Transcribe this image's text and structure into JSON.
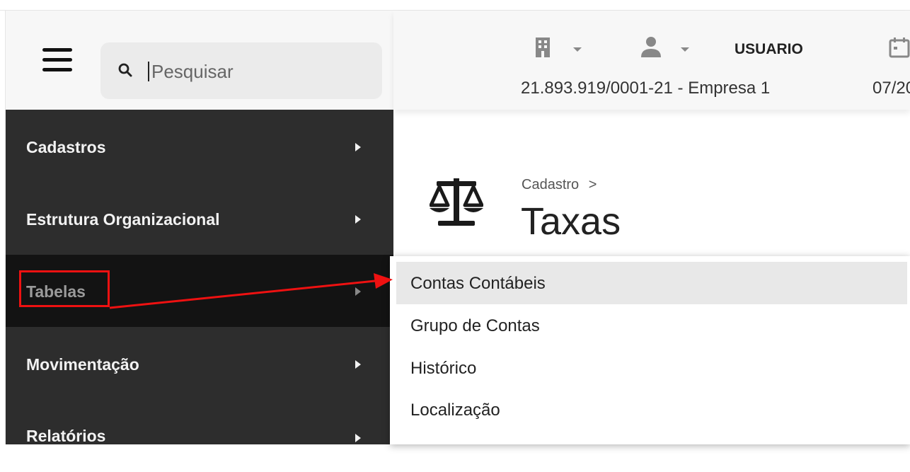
{
  "search": {
    "placeholder": "Pesquisar"
  },
  "header": {
    "user": "USUARIO",
    "company": "21.893.919/0001-21 - Empresa 1",
    "date": "07/20"
  },
  "sidebar": {
    "items": [
      {
        "label": "Cadastros",
        "active": false
      },
      {
        "label": "Estrutura Organizacional",
        "active": false
      },
      {
        "label": "Tabelas",
        "active": true
      },
      {
        "label": "Movimentação",
        "active": false
      },
      {
        "label": "Relatórios",
        "active": false
      }
    ]
  },
  "page": {
    "breadcrumb": "Cadastro",
    "breadcrumb_sep": ">",
    "title": "Taxas",
    "icon": "scale-icon"
  },
  "submenu": {
    "items": [
      {
        "label": "Contas Contábeis",
        "hovered": true
      },
      {
        "label": "Grupo de Contas"
      },
      {
        "label": "Histórico"
      },
      {
        "label": "Localização"
      }
    ]
  },
  "colors": {
    "sidebar_bg": "#2d2d2d",
    "sidebar_active_bg": "#131313",
    "annotation": "#ee1111",
    "header_bg": "#f7f7f7"
  },
  "icons": [
    "menu-icon",
    "search-icon",
    "building-icon",
    "user-icon",
    "calendar-icon",
    "scale-icon",
    "caret-right-icon",
    "chevron-down-icon"
  ]
}
